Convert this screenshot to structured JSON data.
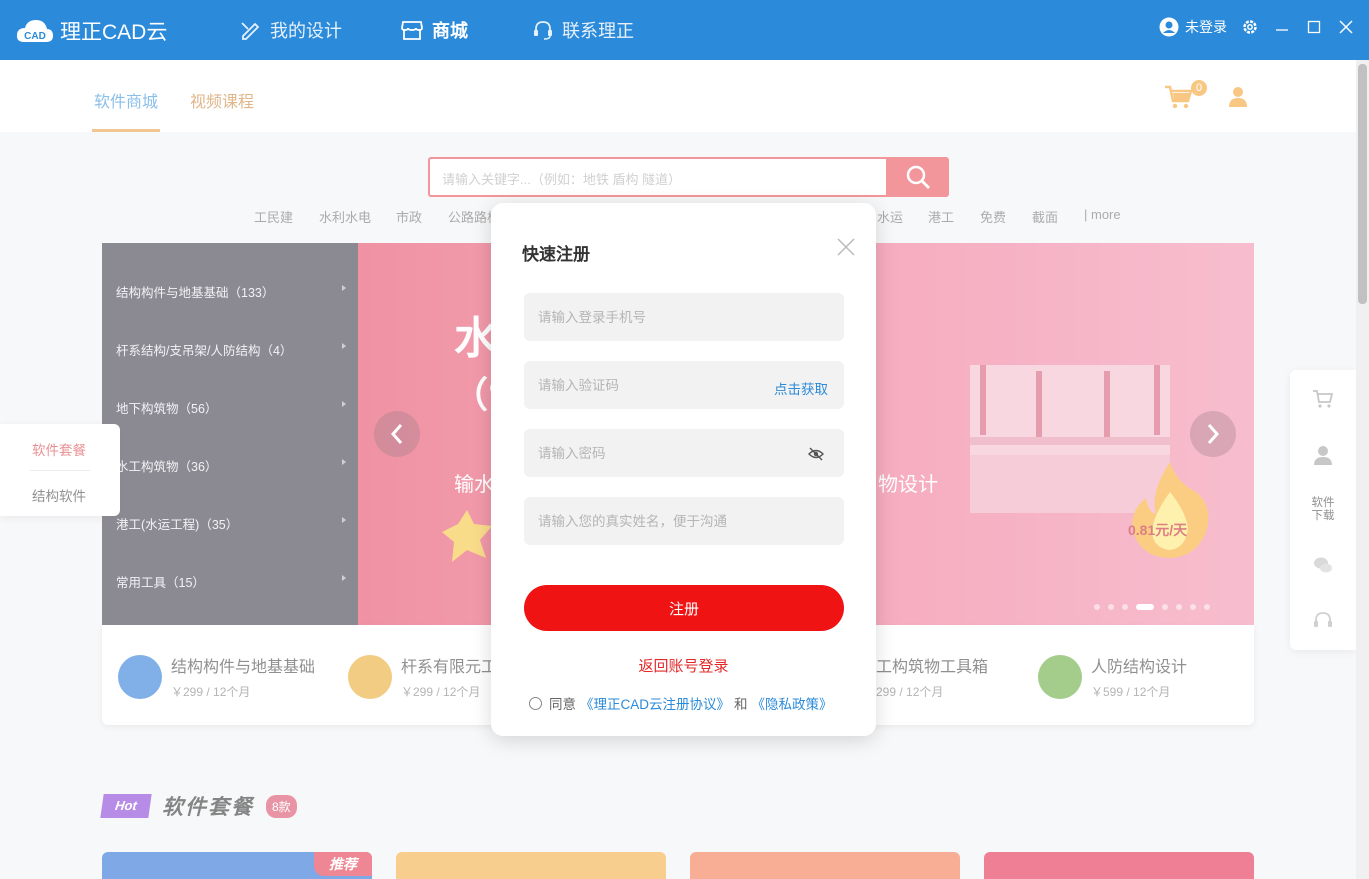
{
  "app": {
    "title": "理正CAD云",
    "logo_text": "CAD"
  },
  "nav": [
    {
      "label": "我的设计",
      "icon": "pencil-ruler-icon"
    },
    {
      "label": "商城",
      "icon": "store-icon"
    },
    {
      "label": "联系理正",
      "icon": "headset-icon"
    }
  ],
  "user": {
    "status": "未登录"
  },
  "subtabs": [
    {
      "label": "软件商城"
    },
    {
      "label": "视频课程"
    }
  ],
  "cart": {
    "count": "0"
  },
  "search": {
    "placeholder": "请输入关键字...（例如：地铁 盾构 隧道）"
  },
  "categories_links": [
    "工民建",
    "水利水电",
    "市政",
    "公路路桥",
    "水运",
    "港工",
    "免费",
    "截面",
    "| more"
  ],
  "sidebar_categories": [
    "结构构件与地基基础（133）",
    "杆系结构/支吊架/人防结构（4）",
    "地下构筑物（56）",
    "水工构筑物（36）",
    "港工(水运工程)（35）",
    "常用工具（15）"
  ],
  "banner": {
    "title_partial": "水",
    "sub_partial": "（ᑦ",
    "line_left": "输水",
    "line_right": "物设计",
    "price": "0.81元/天"
  },
  "products": [
    {
      "name": "结构构件与地基基础",
      "price": "￥299 / 12个月",
      "color": "#1a6fd6"
    },
    {
      "name": "杆系有限元工",
      "price": "￥299 / 12个月",
      "color": "#e6a21c"
    },
    {
      "name": "工构筑物工具箱",
      "price": "299 / 12个月",
      "color": "#3a8de0"
    },
    {
      "name": "人防结构设计",
      "price": "￥599 / 12个月",
      "color": "#5aa22b"
    }
  ],
  "section": {
    "hot": "Hot",
    "title": "软件套餐",
    "count": "8款",
    "recommend": "推荐"
  },
  "left_float": {
    "items": [
      "软件套餐",
      "结构软件"
    ]
  },
  "right_float": {
    "download_label": "软件下载"
  },
  "modal": {
    "title": "快速注册",
    "phone_placeholder": "请输入登录手机号",
    "code_placeholder": "请输入验证码",
    "get_code": "点击获取",
    "password_placeholder": "请输入密码",
    "name_placeholder": "请输入您的真实姓名，便于沟通",
    "submit": "注册",
    "back_login": "返回账号登录",
    "agree_prefix": "同意",
    "agreement_link": "《理正CAD云注册协议》",
    "and": "和",
    "privacy_link": "《隐私政策》"
  },
  "colors": {
    "primary": "#2b8ad9",
    "danger": "#ef1313",
    "accent": "#e8973a"
  }
}
